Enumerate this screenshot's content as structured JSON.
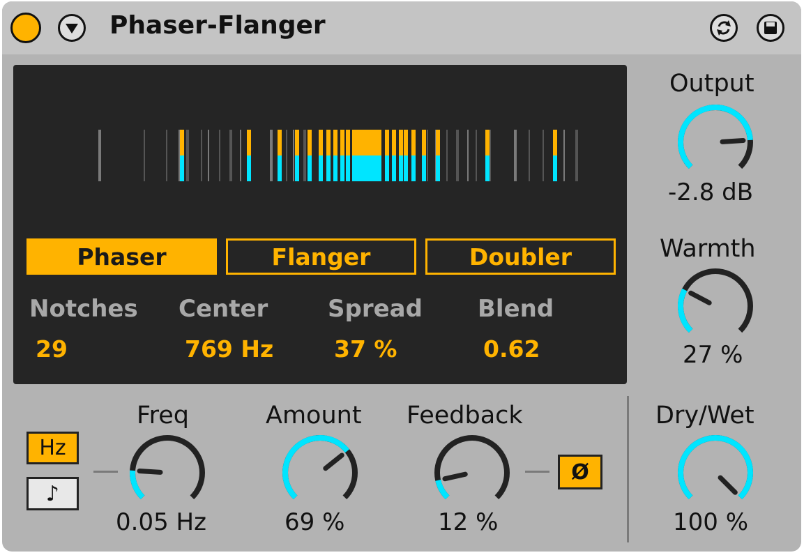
{
  "header": {
    "title": "Phaser-Flanger"
  },
  "modes": [
    "Phaser",
    "Flanger",
    "Doubler"
  ],
  "active_mode": "Phaser",
  "display": {
    "params": [
      {
        "label": "Notches",
        "value": "29"
      },
      {
        "label": "Center",
        "value": "769 Hz"
      },
      {
        "label": "Spread",
        "value": "37 %"
      },
      {
        "label": "Blend",
        "value": "0.62"
      }
    ]
  },
  "knobs": {
    "output": {
      "label": "Output",
      "value": "-2.8 dB",
      "level": 0.82
    },
    "warmth": {
      "label": "Warmth",
      "value": "27 %",
      "level": 0.27
    },
    "drywet": {
      "label": "Dry/Wet",
      "value": "100 %",
      "level": 1.0
    },
    "freq": {
      "label": "Freq",
      "value": "0.05 Hz",
      "level": 0.18
    },
    "amount": {
      "label": "Amount",
      "value": "69 %",
      "level": 0.69
    },
    "feedback": {
      "label": "Feedback",
      "value": "12 %",
      "level": 0.12
    }
  },
  "rate_mode": {
    "hz_label": "Hz",
    "sync_symbol": "♪"
  },
  "phase_invert": {
    "symbol": "Ø"
  },
  "colors": {
    "accent": "#ffb300",
    "cyan": "#00e5ff",
    "screen": "#252525",
    "panel": "#b3b3b3"
  }
}
